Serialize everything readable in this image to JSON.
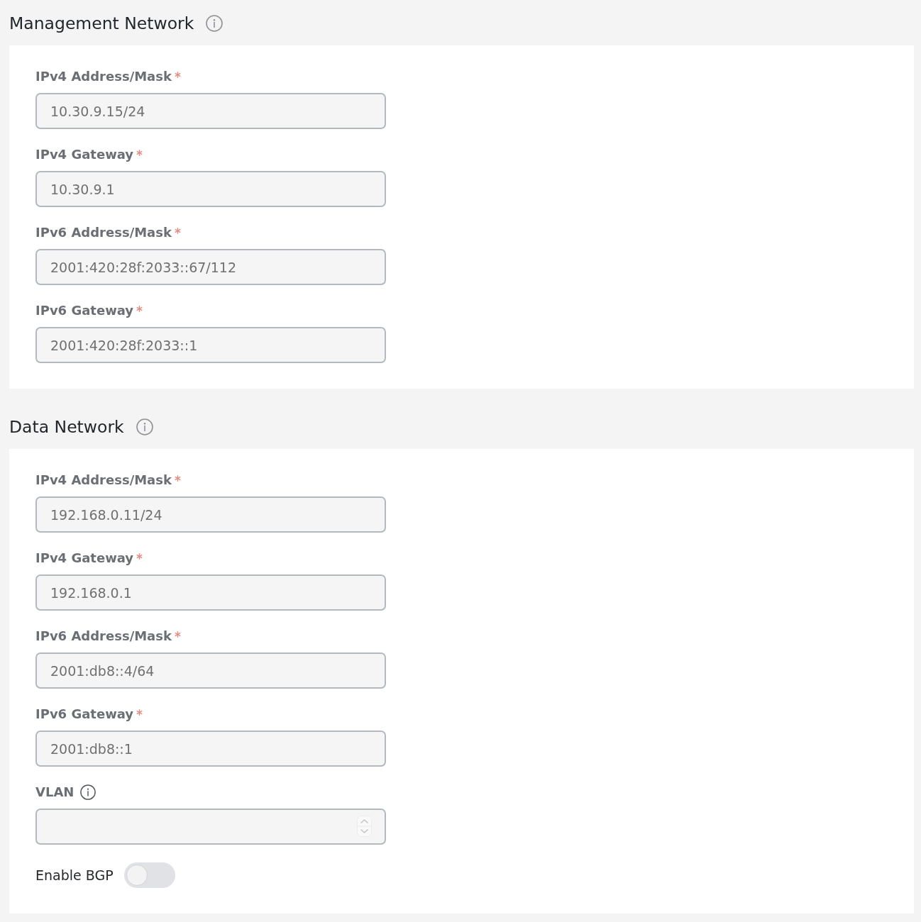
{
  "sections": [
    {
      "title": "Management Network",
      "info": true,
      "fields": [
        {
          "kind": "text",
          "label": "IPv4 Address/Mask",
          "required": true,
          "info": false,
          "value": "10.30.9.15/24"
        },
        {
          "kind": "text",
          "label": "IPv4 Gateway",
          "required": true,
          "info": false,
          "value": "10.30.9.1"
        },
        {
          "kind": "text",
          "label": "IPv6 Address/Mask",
          "required": true,
          "info": false,
          "value": "2001:420:28f:2033::67/112"
        },
        {
          "kind": "text",
          "label": "IPv6 Gateway",
          "required": true,
          "info": false,
          "value": "2001:420:28f:2033::1"
        }
      ]
    },
    {
      "title": "Data Network",
      "info": true,
      "fields": [
        {
          "kind": "text",
          "label": "IPv4 Address/Mask",
          "required": true,
          "info": false,
          "value": "192.168.0.11/24"
        },
        {
          "kind": "text",
          "label": "IPv4 Gateway",
          "required": true,
          "info": false,
          "value": "192.168.0.1"
        },
        {
          "kind": "text",
          "label": "IPv6 Address/Mask",
          "required": true,
          "info": false,
          "value": "2001:db8::4/64"
        },
        {
          "kind": "text",
          "label": "IPv6 Gateway",
          "required": true,
          "info": false,
          "value": "2001:db8::1"
        },
        {
          "kind": "number",
          "label": "VLAN",
          "required": false,
          "info": true
        },
        {
          "kind": "toggle",
          "label": "Enable BGP",
          "required": false,
          "info": false,
          "on": false
        }
      ]
    }
  ]
}
